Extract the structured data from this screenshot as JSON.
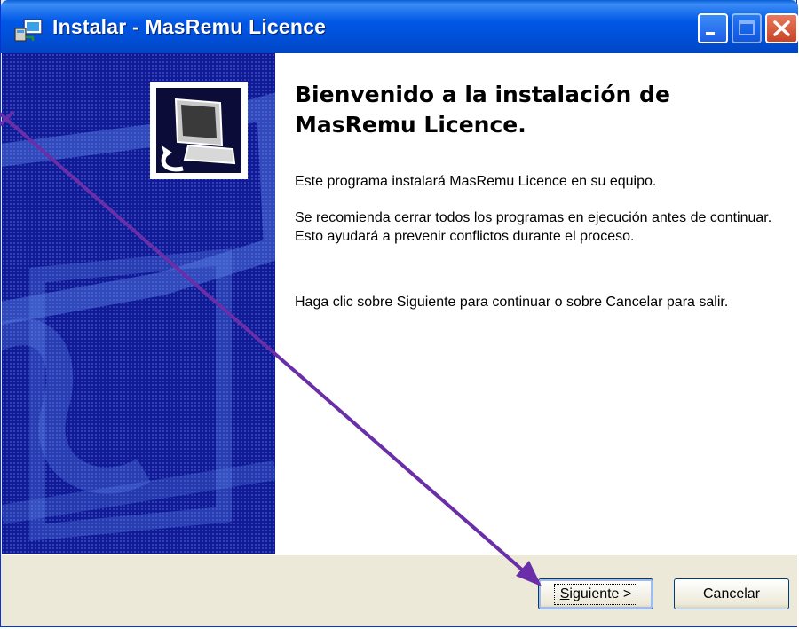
{
  "window": {
    "title": "Instalar - MasRemu Licence",
    "title_icon": "installer-icon",
    "controls": [
      "minimize-icon",
      "maximize-icon",
      "close-icon"
    ]
  },
  "welcome": {
    "heading": "Bienvenido a la instalación de MasRemu Licence.",
    "paragraphs": [
      "Este programa instalará MasRemu Licence en su equipo.",
      "Se recomienda cerrar todos los programas en ejecución antes de continuar.  Esto ayudará a prevenir conflictos durante el proceso.",
      "Haga clic sobre Siguiente para continuar o sobre Cancelar para salir."
    ]
  },
  "buttons": {
    "next_accel": "S",
    "next_rest": "iguiente >",
    "cancel": "Cancelar"
  },
  "colors": {
    "titlebar": "#0058e6",
    "left_panel": "#0e1a9a",
    "annotation_arrow": "#6a2ea8"
  }
}
